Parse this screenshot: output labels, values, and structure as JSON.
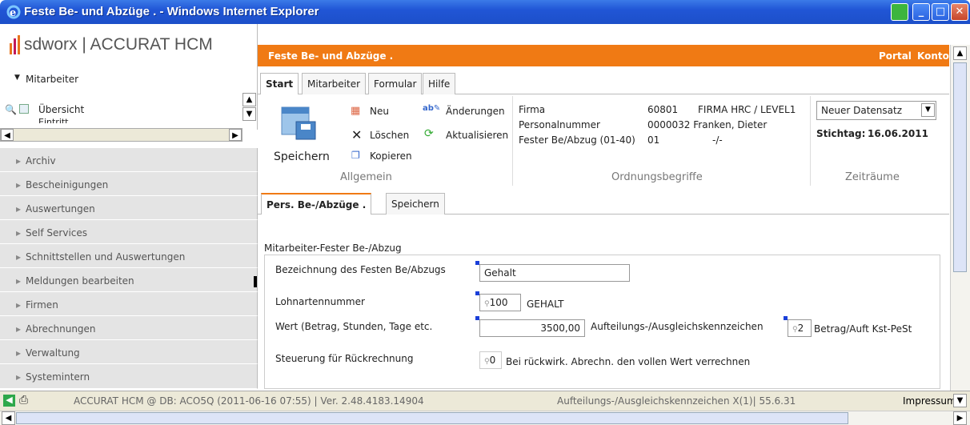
{
  "window": {
    "title": "Feste Be- und Abzüge . - Windows Internet Explorer"
  },
  "brand": {
    "logo": "sdworx",
    "product": "ACCURAT HCM"
  },
  "sidebar": {
    "section": "Mitarbeiter",
    "tree": [
      "Übersicht",
      "Eintritt"
    ],
    "items": [
      "Archiv",
      "Bescheinigungen",
      "Auswertungen",
      "Self Services",
      "Schnittstellen und Auswertungen",
      "Meldungen bearbeiten",
      "Firmen",
      "Abrechnungen",
      "Verwaltung",
      "Systemintern"
    ]
  },
  "header": {
    "title": "Feste Be- und Abzüge .",
    "portal": "Portal",
    "konto": "Konto"
  },
  "tabs": [
    "Start",
    "Mitarbeiter",
    "Formular",
    "Hilfe"
  ],
  "ribbon": {
    "speichern": "Speichern",
    "neu": "Neu",
    "loeschen": "Löschen",
    "kopieren": "Kopieren",
    "aenderungen": "Änderungen",
    "aktualisieren": "Aktualisieren",
    "group_allgemein": "Allgemein",
    "firma_label": "Firma",
    "firma_nr": "60801",
    "firma_name": "FIRMA HRC / LEVEL1",
    "pnr_label": "Personalnummer",
    "pnr_value": "0000032 Franken, Dieter",
    "fba_label": "Fester Be/Abzug (01-40)",
    "fba_value": "01",
    "fba_extra": "-/-",
    "group_ordnung": "Ordnungsbegriffe",
    "select_value": "Neuer Datensatz",
    "stichtag_label": "Stichtag:",
    "stichtag_value": "16.06.2011",
    "group_zeit": "Zeiträume"
  },
  "subtabs": [
    "Pers. Be-/Abzüge .",
    "Speichern"
  ],
  "form": {
    "section": "Mitarbeiter-Fester Be-/Abzug",
    "bez_label": "Bezeichnung des Festen Be/Abzugs",
    "bez_value": "Gehalt",
    "lohn_label": "Lohnartennummer",
    "lohn_value": "100",
    "lohn_text": "GEHALT",
    "wert_label": "Wert (Betrag, Stunden, Tage etc.",
    "wert_value": "3500,00",
    "auft_label": "Aufteilungs-/Ausgleichskennzeichen",
    "auft_value": "2",
    "auft_text": "Betrag/Auft Kst-PeSt",
    "steu_label": "Steuerung für Rückrechnung",
    "steu_value": "0",
    "steu_text": "Bei rückwirk. Abrechn. den vollen Wert verrechnen"
  },
  "status": {
    "text": "ACCURAT HCM @ DB: ACO5Q (2011-06-16 07:55) | Ver. 2.48.4183.14904",
    "right": "Aufteilungs-/Ausgleichskennzeichen X(1)| 55.6.31",
    "impressum": "Impressum"
  },
  "colors": {
    "orange": "#f07a14",
    "titlebar": "#2156d6"
  }
}
